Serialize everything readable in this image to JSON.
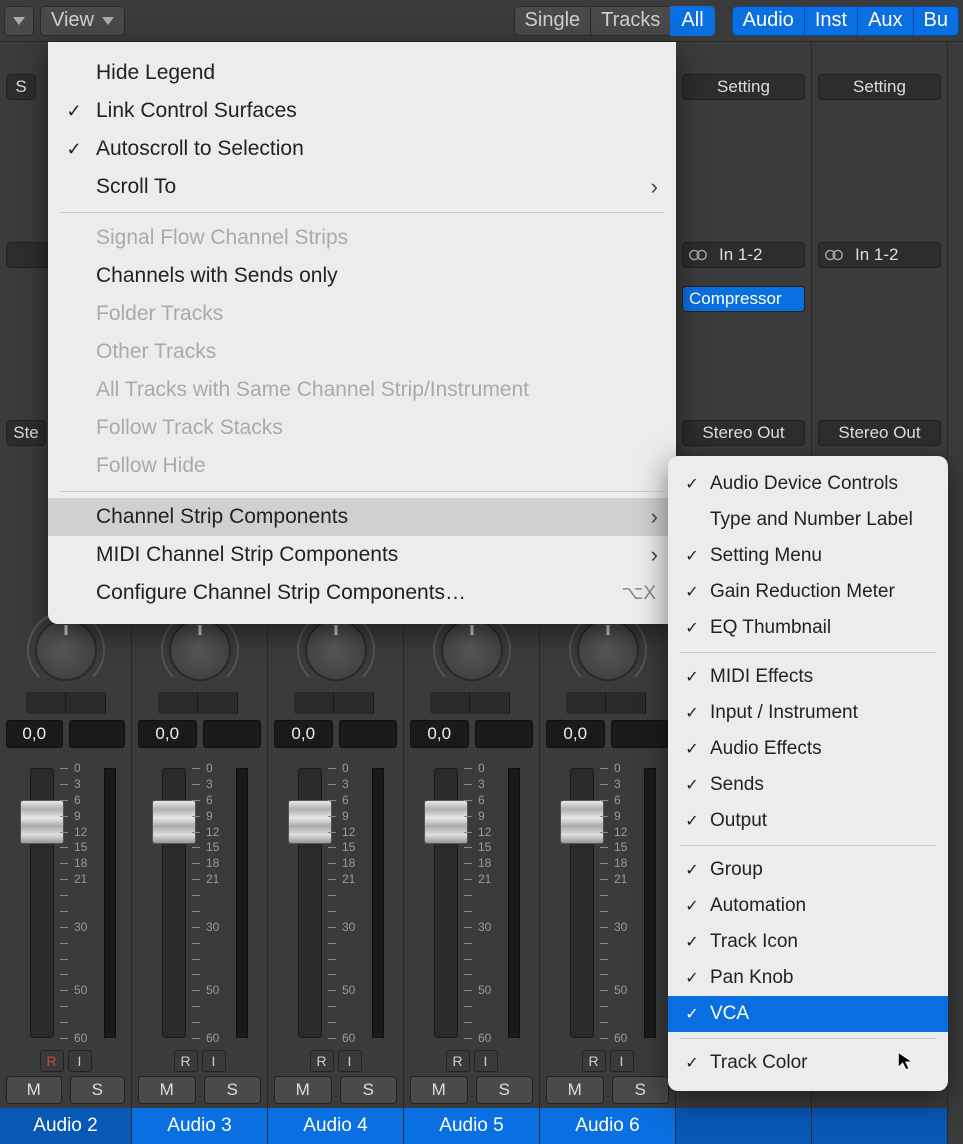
{
  "toolbar": {
    "view_label": "View",
    "seg1": [
      "Single",
      "Tracks",
      "All"
    ],
    "seg1_selected": 2,
    "seg2": [
      "Audio",
      "Inst",
      "Aux",
      "Bu"
    ]
  },
  "menu1": {
    "items": [
      {
        "label": "Hide Legend",
        "checked": false,
        "enabled": true
      },
      {
        "label": "Link Control Surfaces",
        "checked": true,
        "enabled": true
      },
      {
        "label": "Autoscroll to Selection",
        "checked": true,
        "enabled": true
      },
      {
        "label": "Scroll To",
        "checked": false,
        "enabled": true,
        "submenu": true
      }
    ],
    "items2": [
      {
        "label": "Signal Flow Channel Strips",
        "enabled": false
      },
      {
        "label": "Channels with Sends only",
        "enabled": true
      },
      {
        "label": "Folder Tracks",
        "enabled": false
      },
      {
        "label": "Other Tracks",
        "enabled": false
      },
      {
        "label": "All Tracks with Same Channel Strip/Instrument",
        "enabled": false
      },
      {
        "label": "Follow Track Stacks",
        "enabled": false
      },
      {
        "label": "Follow Hide",
        "enabled": false
      }
    ],
    "items3": [
      {
        "label": "Channel Strip Components",
        "enabled": true,
        "submenu": true,
        "highlighted": true
      },
      {
        "label": "MIDI Channel Strip Components",
        "enabled": true,
        "submenu": true
      },
      {
        "label": "Configure Channel Strip Components…",
        "enabled": true,
        "shortcut": "⌥X"
      }
    ]
  },
  "menu2": {
    "group1": [
      {
        "label": "Audio Device Controls",
        "checked": true
      },
      {
        "label": "Type and Number Label",
        "checked": false
      },
      {
        "label": "Setting Menu",
        "checked": true
      },
      {
        "label": "Gain Reduction Meter",
        "checked": true
      },
      {
        "label": "EQ Thumbnail",
        "checked": true
      }
    ],
    "group2": [
      {
        "label": "MIDI Effects",
        "checked": true
      },
      {
        "label": "Input / Instrument",
        "checked": true
      },
      {
        "label": "Audio Effects",
        "checked": true
      },
      {
        "label": "Sends",
        "checked": true
      },
      {
        "label": "Output",
        "checked": true
      }
    ],
    "group3": [
      {
        "label": "Group",
        "checked": true
      },
      {
        "label": "Automation",
        "checked": true
      },
      {
        "label": "Track Icon",
        "checked": true
      },
      {
        "label": "Pan Knob",
        "checked": true
      },
      {
        "label": "VCA",
        "checked": true,
        "selected": true
      }
    ],
    "group4": [
      {
        "label": "Track Color",
        "checked": true
      }
    ]
  },
  "strips": [
    {
      "name": "Audio 2",
      "setting": "S",
      "input": "",
      "stereo_out": "Ste",
      "val": "0,0",
      "rec": true
    },
    {
      "name": "Audio 3",
      "setting": "",
      "input": "",
      "stereo_out": "",
      "val": "0,0",
      "rec": false
    },
    {
      "name": "Audio 4",
      "setting": "",
      "input": "",
      "stereo_out": "",
      "val": "0,0",
      "rec": false
    },
    {
      "name": "Audio 5",
      "setting": "",
      "input": "",
      "stereo_out": "",
      "val": "0,0",
      "rec": false
    },
    {
      "name": "Audio 6",
      "setting": "",
      "input": "",
      "stereo_out": "",
      "val": "0,0",
      "rec": false
    },
    {
      "name": "",
      "setting": "Setting",
      "input": "In 1-2",
      "compressor": "Compressor",
      "stereo_out": "Stereo Out",
      "val": "",
      "rec": false
    },
    {
      "name": "",
      "setting": "Setting",
      "input": "In 1-2",
      "stereo_out": "Stereo Out",
      "val": "",
      "rec": false
    }
  ],
  "fader_scale": [
    "0",
    "3",
    "6",
    "9",
    "12",
    "15",
    "18",
    "21",
    "",
    "",
    "30",
    "",
    "",
    "",
    "50",
    "",
    "",
    "60"
  ]
}
